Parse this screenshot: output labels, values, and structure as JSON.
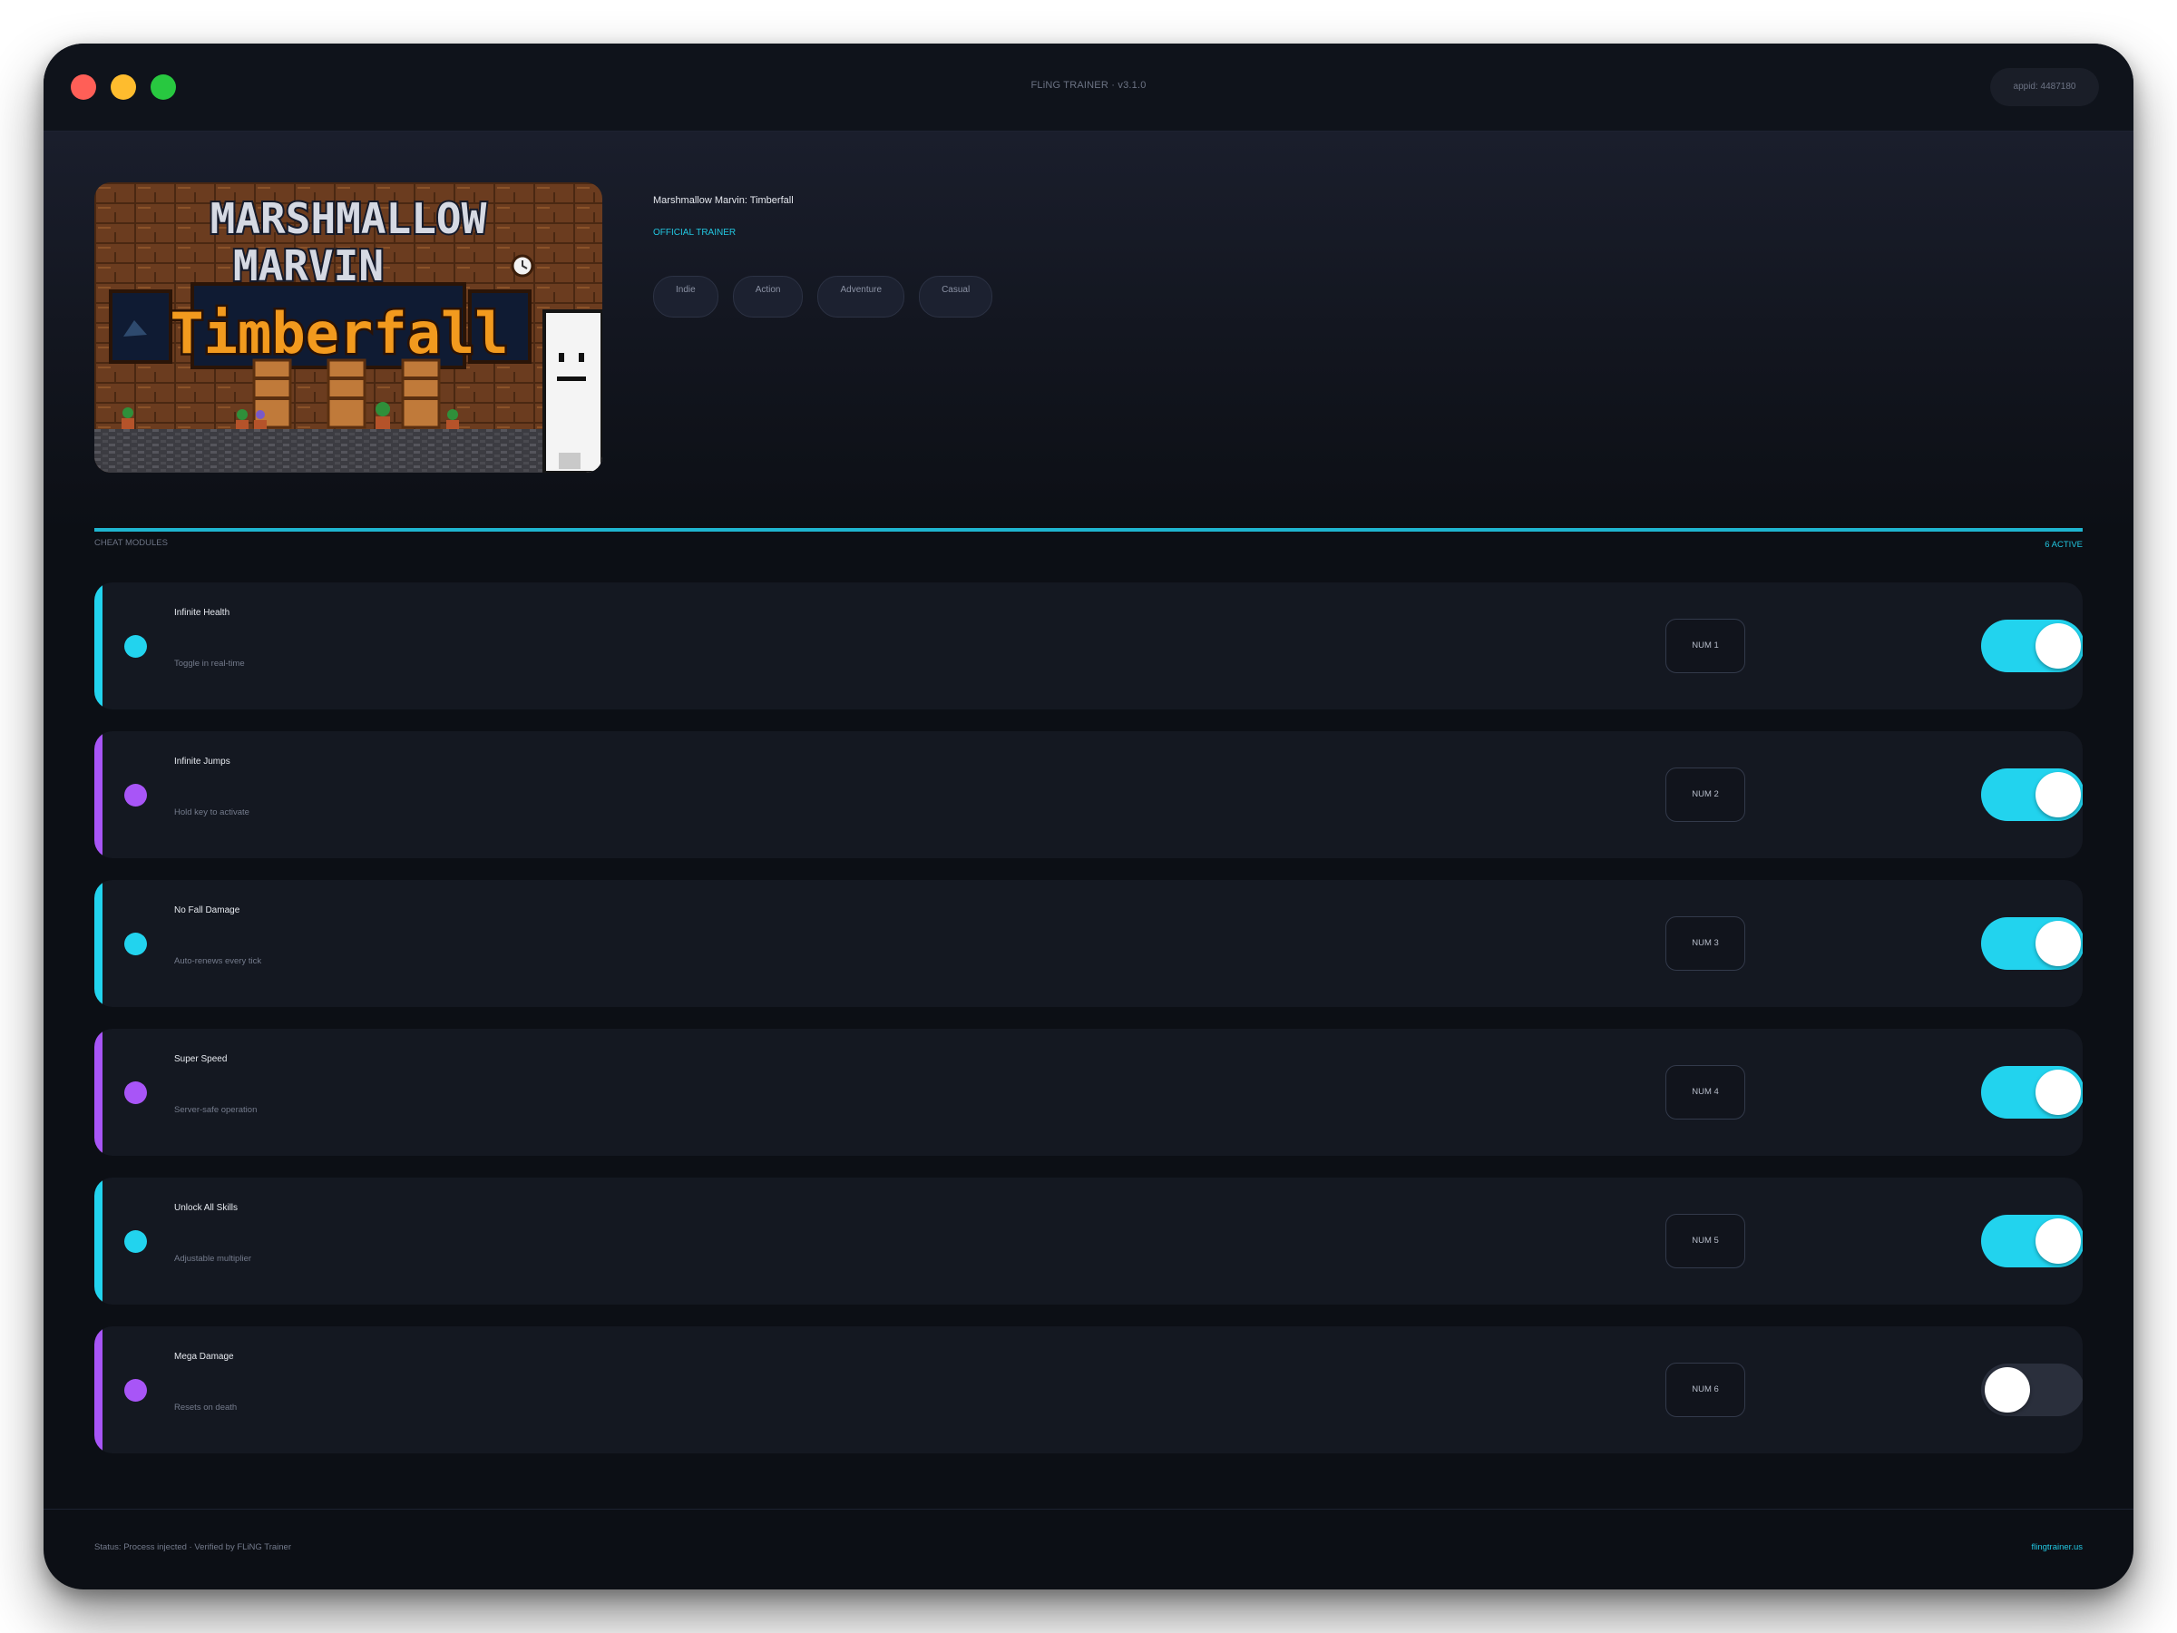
{
  "window": {
    "title": "FLiNG TRAINER · v3.1.0",
    "appid": "appid: 4487180"
  },
  "game": {
    "title": "Marshmallow Marvin: Timberfall",
    "badge": "OFFICIAL TRAINER",
    "cover_art": {
      "title_line1": "MARSHMALLOW",
      "title_line2": "MARVIN",
      "title_line3": "Timberfall"
    },
    "tags": [
      "Indie",
      "Action",
      "Adventure",
      "Casual"
    ]
  },
  "modules_section": {
    "label": "CHEAT MODULES",
    "active": "6 ACTIVE"
  },
  "colors": {
    "cyan": "#22d3ee",
    "purple": "#a855f7",
    "off": "#2a2f3c",
    "background": "#0c0f15"
  },
  "modules": [
    {
      "name": "Infinite Health",
      "desc": "Toggle in real-time",
      "key": "NUM 1",
      "accent": "#22d3ee",
      "enabled": true
    },
    {
      "name": "Infinite Jumps",
      "desc": "Hold key to activate",
      "key": "NUM 2",
      "accent": "#a855f7",
      "enabled": true
    },
    {
      "name": "No Fall Damage",
      "desc": "Auto-renews every tick",
      "key": "NUM 3",
      "accent": "#22d3ee",
      "enabled": true
    },
    {
      "name": "Super Speed",
      "desc": "Server-safe operation",
      "key": "NUM 4",
      "accent": "#a855f7",
      "enabled": true
    },
    {
      "name": "Unlock All Skills",
      "desc": "Adjustable multiplier",
      "key": "NUM 5",
      "accent": "#22d3ee",
      "enabled": true
    },
    {
      "name": "Mega Damage",
      "desc": "Resets on death",
      "key": "NUM 6",
      "accent": "#a855f7",
      "enabled": false
    }
  ],
  "footer": {
    "status": "Status: Process injected · Verified by FLiNG Trainer",
    "site": "flingtrainer.us"
  }
}
